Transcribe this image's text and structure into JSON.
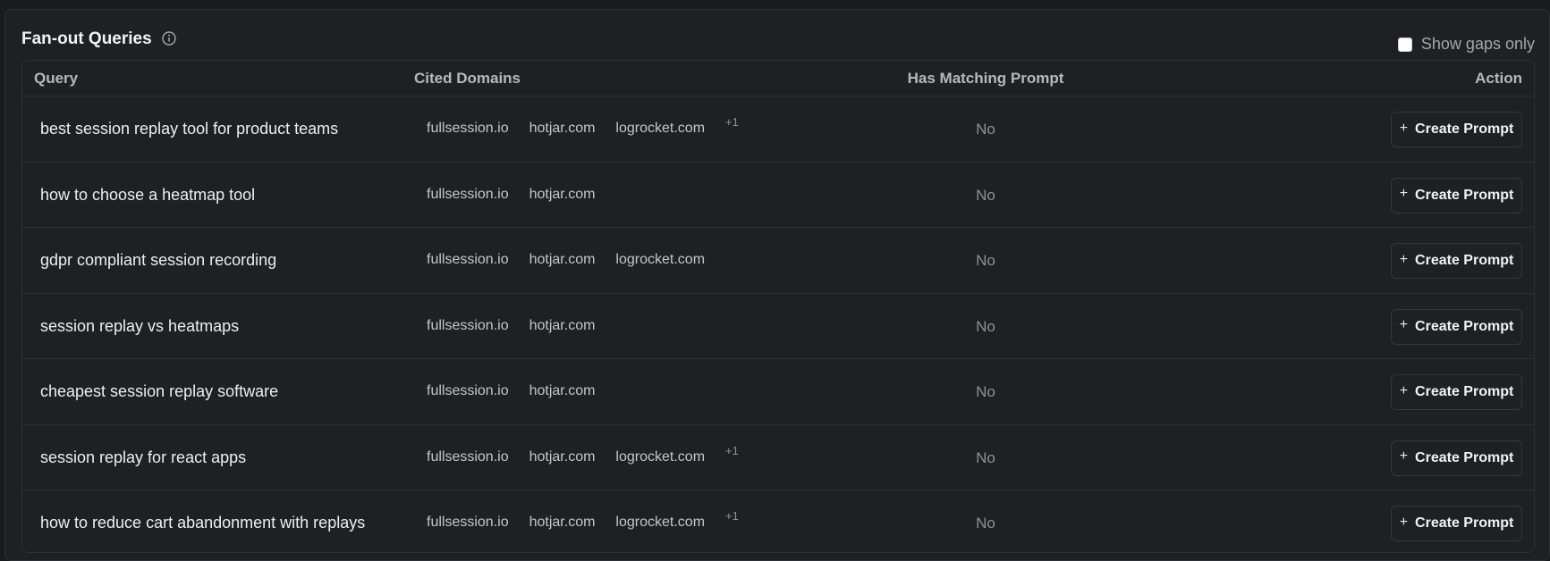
{
  "panel": {
    "title": "Fan-out Queries",
    "info_icon": "info-circle-icon",
    "show_gaps_label": "Show gaps only",
    "show_gaps_checked": false
  },
  "table": {
    "columns": {
      "query": "Query",
      "cited_domains": "Cited Domains",
      "has_matching_prompt": "Has Matching Prompt",
      "action": "Action"
    },
    "action_label": "Create Prompt",
    "action_icon": "plus-icon",
    "rows": [
      {
        "query": "best session replay tool for product teams",
        "domains": [
          "fullsession.io",
          "hotjar.com",
          "logrocket.com"
        ],
        "more": "+1",
        "matching": "No"
      },
      {
        "query": "how to choose a heatmap tool",
        "domains": [
          "fullsession.io",
          "hotjar.com"
        ],
        "more": "",
        "matching": "No"
      },
      {
        "query": "gdpr compliant session recording",
        "domains": [
          "fullsession.io",
          "hotjar.com",
          "logrocket.com"
        ],
        "more": "",
        "matching": "No"
      },
      {
        "query": "session replay vs heatmaps",
        "domains": [
          "fullsession.io",
          "hotjar.com"
        ],
        "more": "",
        "matching": "No"
      },
      {
        "query": "cheapest session replay software",
        "domains": [
          "fullsession.io",
          "hotjar.com"
        ],
        "more": "",
        "matching": "No"
      },
      {
        "query": "session replay for react apps",
        "domains": [
          "fullsession.io",
          "hotjar.com",
          "logrocket.com"
        ],
        "more": "+1",
        "matching": "No"
      },
      {
        "query": "how to reduce cart abandonment with replays",
        "domains": [
          "fullsession.io",
          "hotjar.com",
          "logrocket.com"
        ],
        "more": "+1",
        "matching": "No"
      }
    ]
  }
}
